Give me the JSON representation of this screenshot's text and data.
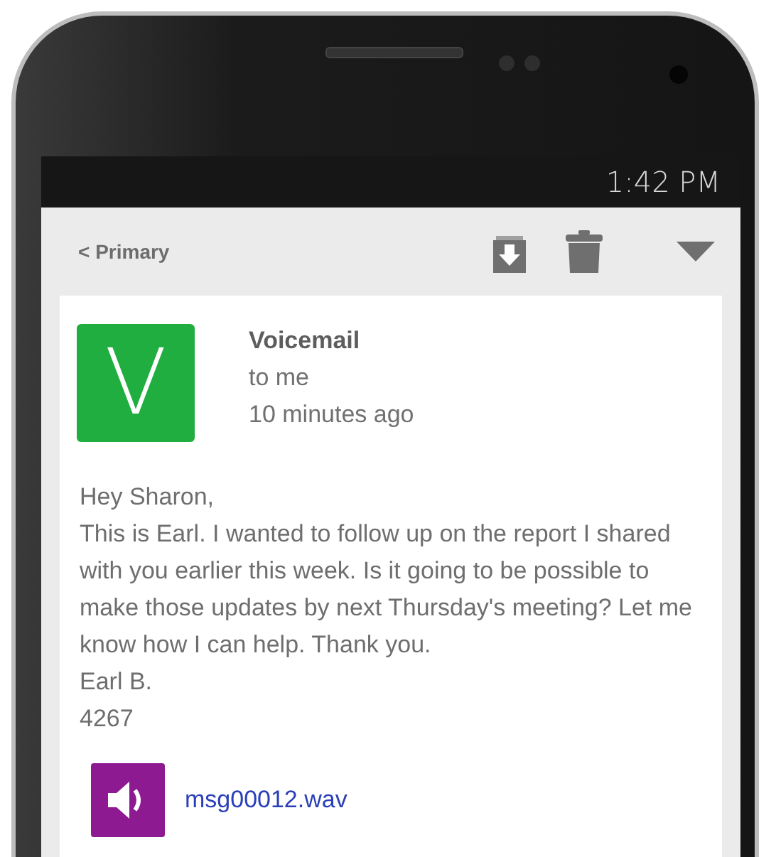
{
  "status_bar": {
    "time": "1:42 PM"
  },
  "toolbar": {
    "back_label": "< Primary"
  },
  "message": {
    "avatar_letter": "V",
    "sender": "Voicemail",
    "recipient": "to me",
    "time": "10 minutes ago",
    "body": [
      {
        "text": "Hey Sharon,"
      },
      {
        "text": "This is Earl. I wanted to follow up on the report I shared with you earlier this week. Is it going to be possible to make those updates by next Thursday's meeting? Let me know how I can help. Thank you."
      },
      {
        "text": "Earl B."
      },
      {
        "text": "4267"
      }
    ],
    "attachment": {
      "filename": "msg00012.wav"
    }
  }
}
